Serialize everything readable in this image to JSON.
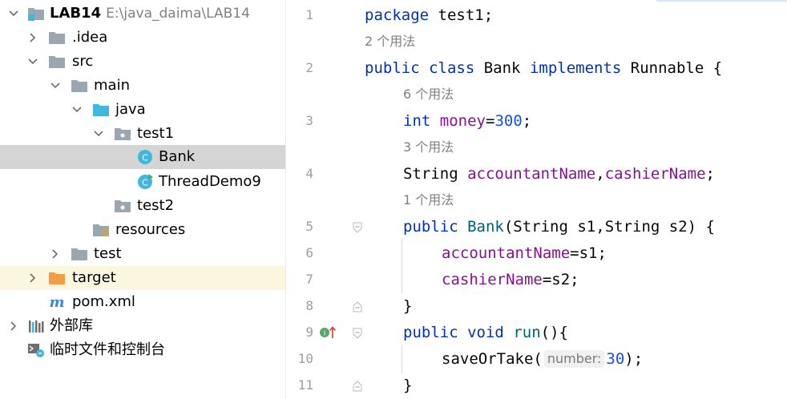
{
  "project_tree": {
    "root": {
      "name": "LAB14",
      "path": "E:\\java_daima\\LAB14"
    },
    "items": [
      {
        "label": ".idea"
      },
      {
        "label": "src"
      },
      {
        "label": "main"
      },
      {
        "label": "java"
      },
      {
        "label": "test1"
      },
      {
        "label": "Bank"
      },
      {
        "label": "ThreadDemo9"
      },
      {
        "label": "test2"
      },
      {
        "label": "resources"
      },
      {
        "label": "test"
      },
      {
        "label": "target"
      },
      {
        "label": "pom.xml"
      },
      {
        "label": "外部库"
      },
      {
        "label": "临时文件和控制台"
      }
    ]
  },
  "editor": {
    "usage_hints": [
      "2 个用法",
      "6 个用法",
      "3 个用法",
      "1 个用法"
    ],
    "line_numbers": [
      "1",
      "2",
      "3",
      "4",
      "5",
      "6",
      "7",
      "8",
      "9",
      "10",
      "11"
    ],
    "code": {
      "l1": {
        "kw": "package",
        "rest": " test1;"
      },
      "l2": {
        "kw1": "public",
        "kw2": "class",
        "name": " Bank ",
        "kw3": "implements",
        "rest": " Runnable {"
      },
      "l3": {
        "kw": "int",
        "field": "money",
        "op": "=",
        "num": "300",
        "end": ";"
      },
      "l4": {
        "type": "String ",
        "f1": "accountantName",
        "sep": ",",
        "f2": "cashierName",
        "end": ";"
      },
      "l5": {
        "kw": "public",
        "ctor": "Bank",
        "rest": "(String s1,String s2) {"
      },
      "l6": {
        "field": "accountantName",
        "rest": "=s1;"
      },
      "l7": {
        "field": "cashierName",
        "rest": "=s2;"
      },
      "l8": {
        "text": "}"
      },
      "l9": {
        "kw1": "public",
        "kw2": "void",
        "fn": "run",
        "rest": "(){"
      },
      "l10": {
        "call": "saveOrTake(",
        "hint": "number:",
        "num": "30",
        "end": ");"
      },
      "l11": {
        "text": "}"
      }
    }
  },
  "colors": {
    "keyword": "#0033b3",
    "field": "#871094",
    "number": "#1750eb",
    "function": "#00627a",
    "selection": "#d5d5d5",
    "excluded_bg": "#fbf7df"
  }
}
